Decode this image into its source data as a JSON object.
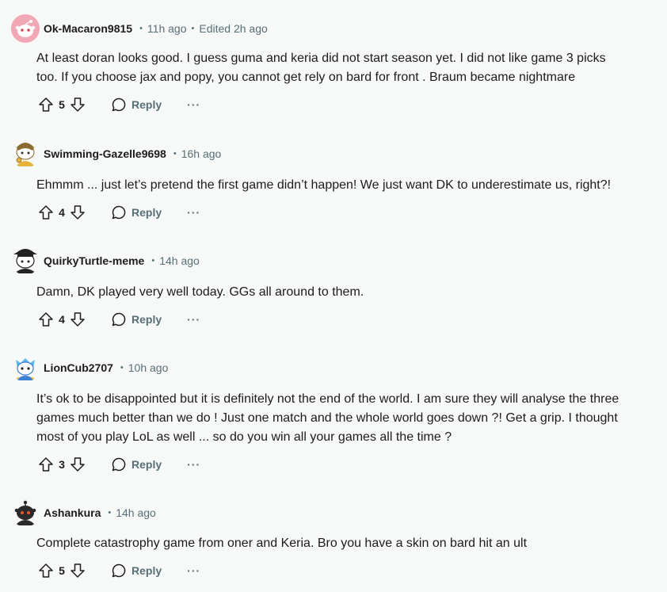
{
  "comments": [
    {
      "author": "Ok-Macaron9815",
      "time": "11h ago",
      "edited": "Edited 2h ago",
      "lines": [
        "At least doran looks good.  I guess guma and keria did not start season yet.  I did not like game 3 picks",
        "too. If you choose jax and popy,  you cannot get rely on bard for front . Braum became nightmare"
      ],
      "score": "5",
      "reply_label": "Reply",
      "more_label": "···"
    },
    {
      "author": "Swimming-Gazelle9698",
      "time": "16h ago",
      "lines": [
        "Ehmmm ... just let’s pretend the first game didn’t happen! We just want DK to underestimate us, right?!"
      ],
      "score": "4",
      "reply_label": "Reply",
      "more_label": "···"
    },
    {
      "author": "QuirkyTurtle-meme",
      "time": "14h ago",
      "lines": [
        "Damn, DK played very well today. GGs all around to them."
      ],
      "score": "4",
      "reply_label": "Reply",
      "more_label": "···"
    },
    {
      "author": "LionCub2707",
      "time": "10h ago",
      "lines": [
        "It’s ok to be disappointed but it is definitely not the end of the world. I am sure they will analyse the three",
        "games much better than we do ! Just one match and the whole world goes down ?! Get a grip. I thought",
        "most of you play LoL as well ... so do you win all your games all the time ?"
      ],
      "score": "3",
      "reply_label": "Reply",
      "more_label": "···"
    },
    {
      "author": "Ashankura",
      "time": "14h ago",
      "lines": [
        "Complete catastrophy game from oner and Keria. Bro you have a skin on bard hit an ult"
      ],
      "score": "5",
      "reply_label": "Reply",
      "more_label": "···"
    }
  ],
  "meta_separator": "•",
  "colors": {
    "background": "#f7f8f8",
    "text": "#1c1c1c",
    "muted": "#576f76",
    "avatar_pink": "#f2a7b5"
  },
  "icons": [
    "upvote-icon",
    "downvote-icon",
    "comment-bubble-icon",
    "more-options-icon"
  ]
}
